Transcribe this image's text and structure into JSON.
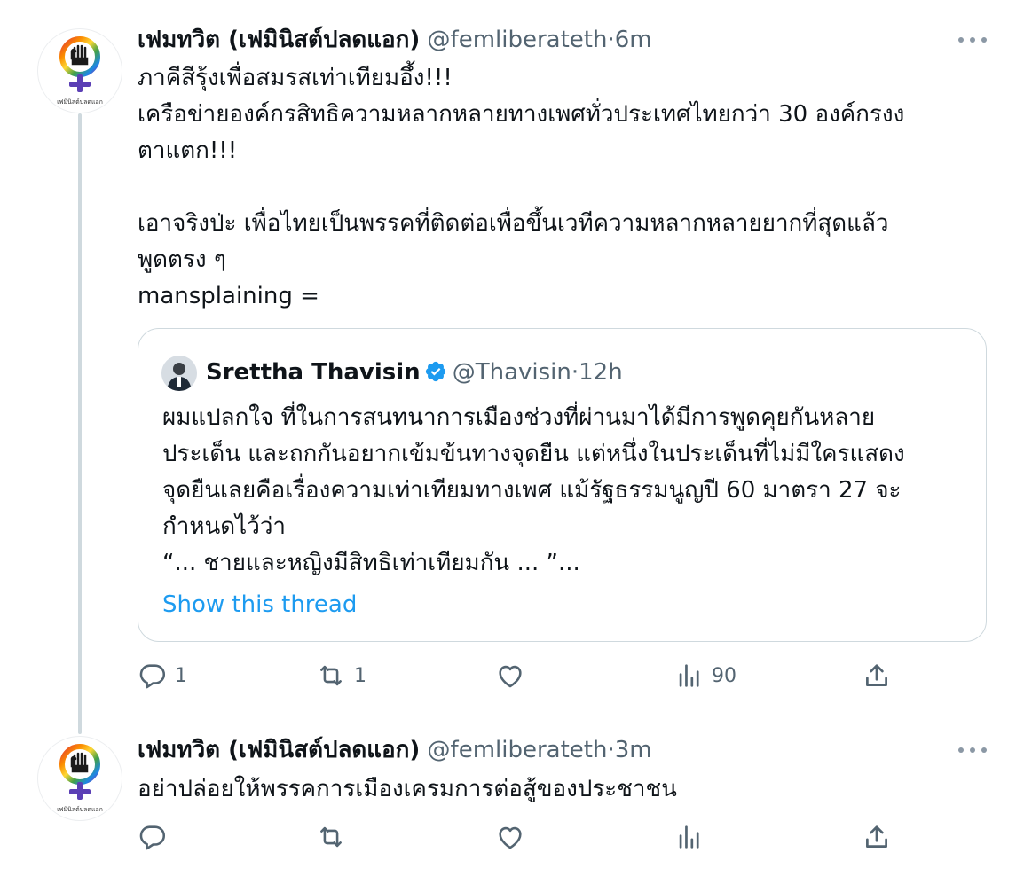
{
  "tweets": [
    {
      "author_name": "เฟมทวิต (เฟมินิสต์ปลดแอก)",
      "handle": "@femliberateth",
      "separator": "·",
      "time": "6m",
      "avatar_label": "เฟมินิสต์ปลดแอก",
      "lines": [
        "ภาคีสีรุ้งเพื่อสมรสเท่าเทียมอึ้ง!!!",
        "เครือข่ายองค์กรสิทธิความหลากหลายทางเพศทั่วประเทศไทยกว่า 30 องค์กรงง",
        "ตาแตก!!!",
        "",
        "เอาจริงป่ะ เพื่อไทยเป็นพรรคที่ติดต่อเพื่อขึ้นเวทีความหลากหลายยากที่สุดแล้ว",
        "พูดตรง ๆ",
        "mansplaining ="
      ],
      "quote": {
        "author_name": "Srettha Thavisin",
        "handle": "@Thavisin",
        "separator": "·",
        "time": "12h",
        "lines": [
          "ผมแปลกใจ ที่ในการสนทนาการเมืองช่วงที่ผ่านมาได้มีการพูดคุยกันหลาย",
          "ประเด็น และถกกันอยากเข้มข้นทางจุดยืน แต่หนึ่งในประเด็นที่ไม่มีใครแสดง",
          "จุดยืนเลยคือเรื่องความเท่าเทียมทางเพศ แม้รัฐธรรมนูญปี 60 มาตรา 27 จะ",
          "กำหนดไว้ว่า",
          "“... ชายและหญิงมีสิทธิเท่าเทียมกัน ... ”..."
        ],
        "show_thread": "Show this thread"
      },
      "actions": {
        "replies": "1",
        "retweets": "1",
        "likes": "",
        "views": "90"
      }
    },
    {
      "author_name": "เฟมทวิต (เฟมินิสต์ปลดแอก)",
      "handle": "@femliberateth",
      "separator": "·",
      "time": "3m",
      "avatar_label": "เฟมินิสต์ปลดแอก",
      "lines": [
        "อย่าปล่อยให้พรรคการเมืองเครมการต่อสู้ของประชาชน"
      ],
      "actions": {
        "replies": "",
        "retweets": "",
        "likes": "",
        "views": ""
      }
    }
  ],
  "colors": {
    "text": "#0f1419",
    "secondary": "#536471",
    "link": "#1d9bf0",
    "border": "#cfd9de",
    "verified": "#1d9bf0",
    "rainbow": [
      "#e53935",
      "#fb8c00",
      "#fdd835",
      "#43a047",
      "#1e88e5",
      "#8e24aa"
    ]
  },
  "icons": [
    "reply-icon",
    "retweet-icon",
    "like-icon",
    "views-icon",
    "share-icon",
    "more-icon",
    "verified-badge-icon"
  ]
}
